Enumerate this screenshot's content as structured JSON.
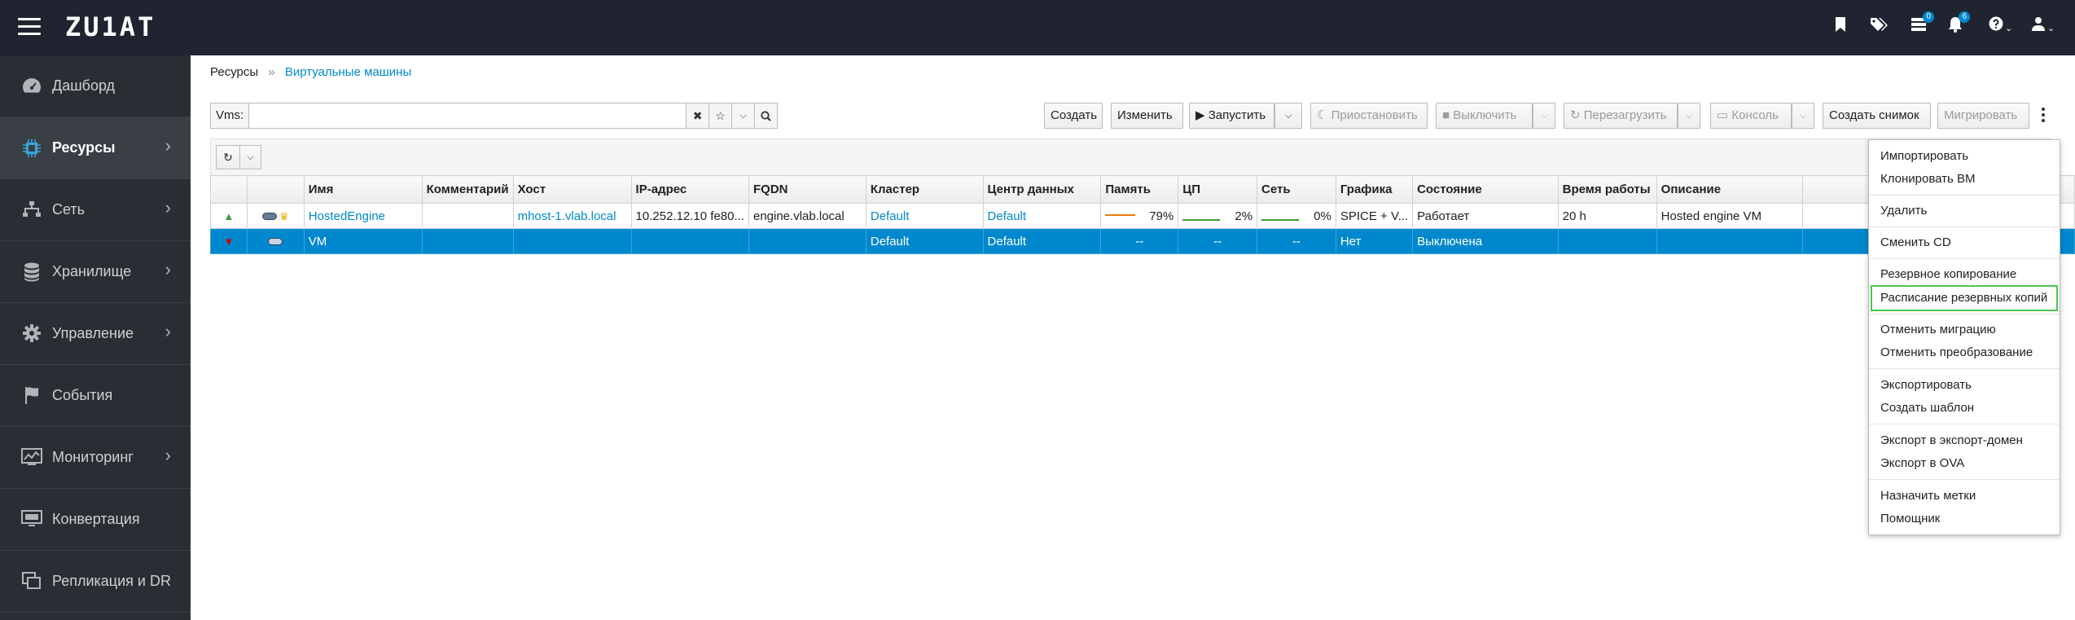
{
  "app": {
    "logo": "ZU1AT"
  },
  "topbar": {
    "icons": [
      "bookmark-icon",
      "tags-icon",
      "tasks-icon",
      "bell-icon",
      "help-icon",
      "user-icon"
    ],
    "tasks_badge": "0",
    "notifications_badge": "6"
  },
  "sidebar": {
    "items": [
      {
        "label": "Дашборд",
        "icon": "dashboard-icon",
        "chevron": false
      },
      {
        "label": "Ресурсы",
        "icon": "chip-icon",
        "chevron": true,
        "active": true
      },
      {
        "label": "Сеть",
        "icon": "network-icon",
        "chevron": true
      },
      {
        "label": "Хранилище",
        "icon": "database-icon",
        "chevron": true
      },
      {
        "label": "Управление",
        "icon": "gear-icon",
        "chevron": true
      },
      {
        "label": "События",
        "icon": "flag-icon",
        "chevron": false
      },
      {
        "label": "Мониторинг",
        "icon": "chart-icon",
        "chevron": true
      },
      {
        "label": "Конвертация",
        "icon": "monitor-icon",
        "chevron": false
      },
      {
        "label": "Репликация и DR",
        "icon": "copy-icon",
        "chevron": false
      }
    ]
  },
  "breadcrumb": {
    "parent": "Ресурсы",
    "sep": "»",
    "current": "Виртуальные машины"
  },
  "search": {
    "prefix": "Vms:",
    "value": ""
  },
  "toolbar": {
    "create": "Создать",
    "edit": "Изменить",
    "run": "Запустить",
    "suspend": "Приостановить",
    "shutdown": "Выключить",
    "reboot": "Перезагрузить",
    "console": "Консоль",
    "snapshot": "Создать снимок",
    "migrate": "Мигрировать"
  },
  "table": {
    "columns": [
      "",
      "",
      "Имя",
      "Комментарий",
      "Хост",
      "IP-адрес",
      "FQDN",
      "Кластер",
      "Центр данных",
      "Память",
      "ЦП",
      "Сеть",
      "Графика",
      "Состояние",
      "Время работы",
      "Описание"
    ],
    "rows": [
      {
        "status": "up",
        "name": "HostedEngine",
        "comment": "",
        "host": "mhost-1.vlab.local",
        "ip": "10.252.12.10 fe80...",
        "fqdn": "engine.vlab.local",
        "cluster": "Default",
        "datacenter": "Default",
        "memory": "79%",
        "memory_level": 0.79,
        "cpu": "2%",
        "cpu_level": 0.02,
        "network": "0%",
        "network_level": 0.0,
        "graphics": "SPICE + V...",
        "state": "Работает",
        "uptime": "20 h",
        "description": "Hosted engine VM"
      },
      {
        "status": "down",
        "name": "VM",
        "comment": "",
        "host": "",
        "ip": "",
        "fqdn": "",
        "cluster": "Default",
        "datacenter": "Default",
        "memory": "--",
        "cpu": "--",
        "network": "--",
        "graphics": "Нет",
        "state": "Выключена",
        "uptime": "",
        "description": ""
      }
    ]
  },
  "menu": {
    "items": [
      "Импортировать",
      "Клонировать ВМ",
      "Удалить",
      "Сменить CD",
      "Резервное копирование",
      "Расписание резервных копий",
      "Отменить миграцию",
      "Отменить преобразование",
      "Экспортировать",
      "Создать шаблон",
      "Экспорт в экспорт-домен",
      "Экспорт в OVA",
      "Назначить метки",
      "Помощник"
    ]
  },
  "colors": {
    "topbar": "#1f2430",
    "sidebar": "#292e34",
    "accent": "#0088ce",
    "highlight_border": "#4bc74b"
  }
}
